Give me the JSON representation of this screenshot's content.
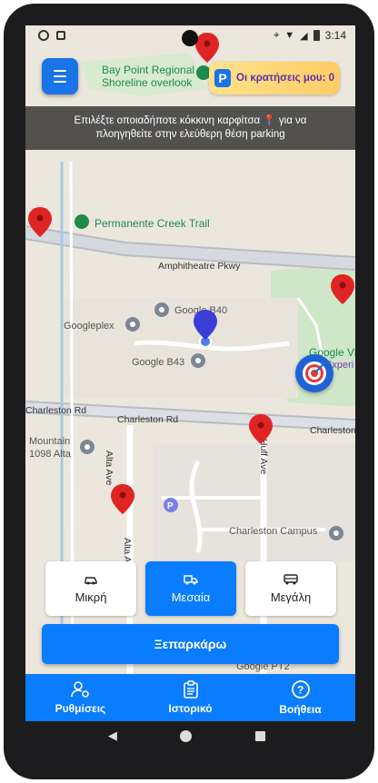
{
  "status_bar": {
    "time": "3:14"
  },
  "map": {
    "labels": {
      "bay_point": "Bay Point Regional",
      "shoreline": "Shoreline overlook",
      "permanente": "Permanente Creek Trail",
      "amphitheatre": "Amphitheatre Pkwy",
      "google_b40": "Google B40",
      "googleplex": "Googleplex",
      "google_b43": "Google B43",
      "google_vi": "Google Vi",
      "experi": "Experi",
      "charleston_rd_left": "Charleston Rd",
      "charleston_rd_mid": "Charleston Rd",
      "charleston_rd_right": "Charleston",
      "mountain": "Mountain",
      "alta_1098": "1098 Alta",
      "alta_ave_1": "Alta Ave",
      "alta_ave_2": "Alta Ave",
      "huff_ave": "Huff Ave",
      "charleston_campus": "Charleston Campus",
      "google_ptz": "Google PT2"
    }
  },
  "booking_chip": {
    "icon": "P",
    "label": "Οι κρατήσεις μου: 0"
  },
  "banner": {
    "line1": "Επιλέξτε οποιαδήποτε κόκκινη καρφίτσα 📍 για να",
    "line2": "πλοηγηθείτε στην ελεύθερη θέση parking"
  },
  "sizes": [
    {
      "label": "Μικρή",
      "icon": "car-small-icon",
      "active": false
    },
    {
      "label": "Μεσαία",
      "icon": "truck-icon",
      "active": true
    },
    {
      "label": "Μεγάλη",
      "icon": "bus-icon",
      "active": false
    }
  ],
  "unpark_label": "Ξεπαρκάρω",
  "bottom_nav": [
    {
      "label": "Ρυθμίσεις",
      "icon": "user-settings-icon"
    },
    {
      "label": "Ιστορικό",
      "icon": "clipboard-icon"
    },
    {
      "label": "Βοήθεια",
      "icon": "help-circle-icon"
    }
  ],
  "colors": {
    "primary": "#0a7cff",
    "pin": "#e02424",
    "chip_text": "#5b2fa8"
  }
}
